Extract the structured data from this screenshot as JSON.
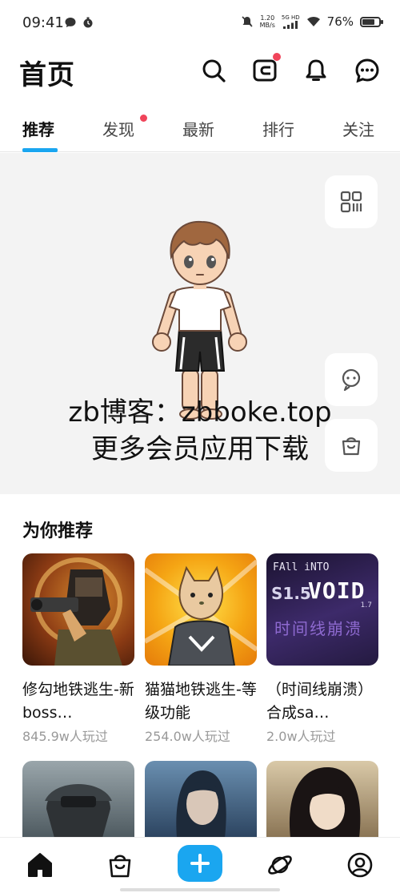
{
  "status_bar": {
    "time": "09:41",
    "net_speed_value": "1.20",
    "net_speed_unit": "MB/s",
    "net_type": "5G HD",
    "battery_text": "76%",
    "battery_level": 0.76
  },
  "header": {
    "title": "首页",
    "icons": [
      "search-icon",
      "wallet-icon",
      "bell-icon",
      "chat-icon"
    ]
  },
  "tabs": [
    {
      "label": "推荐",
      "active": true
    },
    {
      "label": "发现",
      "badge": true
    },
    {
      "label": "最新"
    },
    {
      "label": "排行"
    },
    {
      "label": "关注"
    }
  ],
  "banner": {
    "watermark_line1": "zb博客：zbboke.top",
    "watermark_line2": "更多会员应用下载",
    "side_icons": [
      "scan-icon",
      "support-icon",
      "shop-icon"
    ]
  },
  "section": {
    "title": "为你推荐"
  },
  "cards": [
    {
      "title": "修勾地铁逃生-新boss…",
      "meta": "845.9w人玩过"
    },
    {
      "title": "猫猫地铁逃生-等级功能",
      "meta": "254.0w人玩过"
    },
    {
      "title": "（时间线崩溃）合成sa…",
      "meta": "2.0w人玩过"
    }
  ],
  "cover_art": {
    "void_logo": "VOID",
    "fall_into": "FAll iNTO",
    "version": "S1.5",
    "version_small": "1.7",
    "cn_text": "时间线崩溃"
  },
  "colors": {
    "accent": "#1aa6f0",
    "badge": "#f0445a",
    "meta_text": "#999999",
    "banner_bg": "#f3f3f3"
  },
  "bottom_nav": {
    "items": [
      "home-icon",
      "bag-icon",
      "plus-icon",
      "planet-icon",
      "profile-icon"
    ]
  }
}
